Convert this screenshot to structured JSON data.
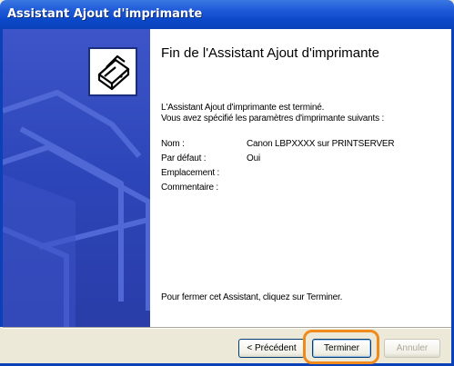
{
  "window": {
    "title": "Assistant Ajout d'imprimante"
  },
  "content": {
    "heading": "Fin de l'Assistant Ajout d'imprimante",
    "intro_line1": "L'Assistant Ajout d'imprimante est terminé.",
    "intro_line2": "Vous avez spécifié les paramètres d'imprimante suivants :",
    "summary": [
      {
        "label": "Nom :",
        "value": "Canon LBPXXXX sur PRINTSERVER"
      },
      {
        "label": "Par défaut :",
        "value": "Oui"
      },
      {
        "label": "Emplacement :",
        "value": ""
      },
      {
        "label": "Commentaire :",
        "value": ""
      }
    ],
    "footer_note": "Pour fermer cet Assistant, cliquez sur Terminer."
  },
  "buttons": {
    "previous": "< Précédent",
    "finish": "Terminer",
    "cancel": "Annuler"
  },
  "colors": {
    "titlebar": "#0a41b8",
    "panel": "#2c45b8",
    "highlight": "#f08a1c"
  }
}
